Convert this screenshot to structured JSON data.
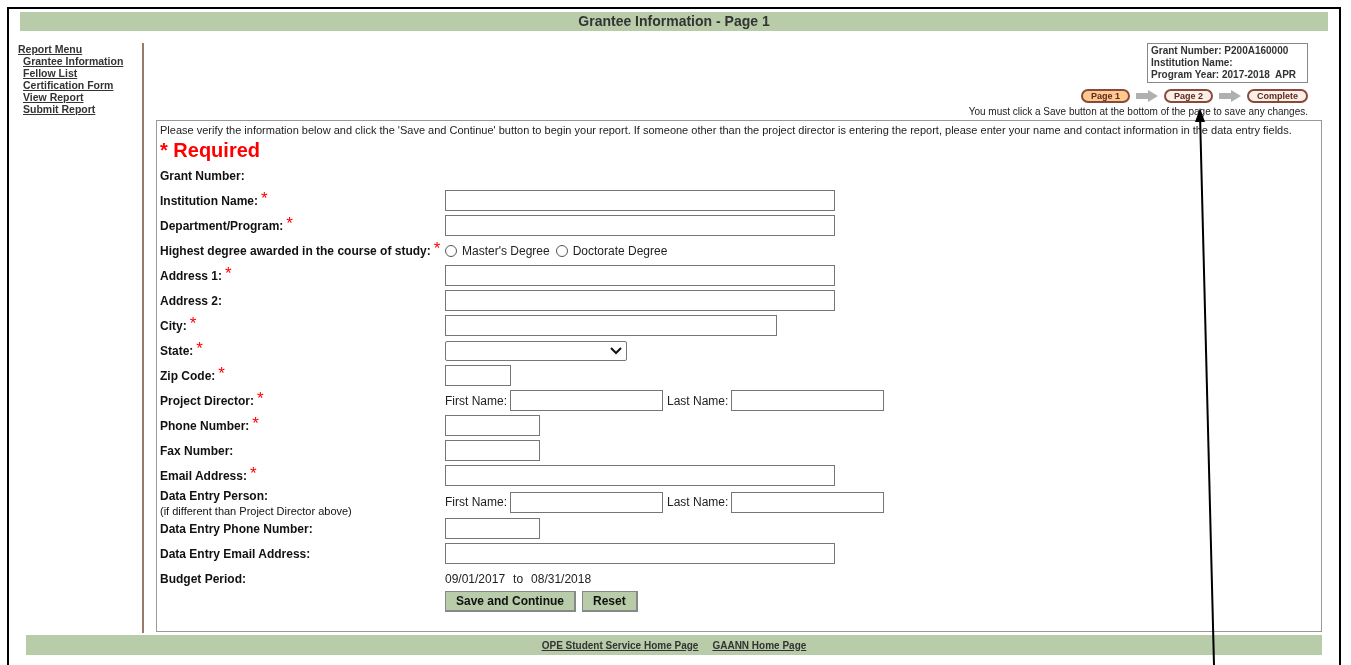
{
  "title": "Grantee Information - Page 1",
  "sidebar": {
    "heading": "Report Menu",
    "items": [
      {
        "label": "Grantee Information"
      },
      {
        "label": "Fellow List"
      },
      {
        "label": "Certification Form"
      },
      {
        "label": "View Report"
      },
      {
        "label": "Submit Report"
      }
    ]
  },
  "info_box": [
    "Grant Number: P200A160000",
    "Institution Name:",
    "Program Year: 2017-2018  APR"
  ],
  "steps": [
    {
      "label": "Page 1",
      "selected": true
    },
    {
      "label": "Page 2",
      "selected": false
    },
    {
      "label": "Complete",
      "selected": false
    }
  ],
  "save_notice": "You must click a Save button at the bottom of the page to save any changes.",
  "intro": "Please verify the information below and click the 'Save and Continue' button to begin your report. If someone other than the project director is entering the report, please enter your name and contact information in the data entry fields.",
  "required_legend": "* Required",
  "required_mark": "*",
  "rows": [
    {
      "kind": "none",
      "label": "Grant Number:",
      "required": false
    },
    {
      "kind": "long-input",
      "label": "Institution Name:",
      "required": true
    },
    {
      "kind": "long-input",
      "label": "Department/Program:",
      "required": true
    },
    {
      "kind": "radio",
      "label": "Highest degree awarded in the course of study:",
      "required": true,
      "options": [
        {
          "label": "Master's Degree",
          "selected": false
        },
        {
          "label": "Doctorate Degree",
          "selected": false
        }
      ]
    },
    {
      "kind": "long-input",
      "label": "Address 1:",
      "required": true
    },
    {
      "kind": "long-input",
      "label": "Address 2:",
      "required": false
    },
    {
      "kind": "medium-input",
      "label": "City:",
      "required": true
    },
    {
      "kind": "select",
      "label": "State:",
      "required": true
    },
    {
      "kind": "tiny-input",
      "label": "Zip Code:",
      "required": true
    },
    {
      "kind": "name",
      "label": "Project Director:",
      "required": true,
      "first": "First Name:",
      "last": "Last Name:"
    },
    {
      "kind": "short-input",
      "label": "Phone Number:",
      "required": true
    },
    {
      "kind": "short-input",
      "label": "Fax Number:",
      "required": false
    },
    {
      "kind": "long-input",
      "label": "Email Address:",
      "required": true
    },
    {
      "kind": "name",
      "label": "Data Entry Person:",
      "note": "(if different than Project Director above)",
      "required": false,
      "first": "First Name:",
      "last": "Last Name:"
    },
    {
      "kind": "short-input",
      "label": "Data Entry Phone Number:",
      "required": false
    },
    {
      "kind": "long-input",
      "label": "Data Entry Email Address:",
      "required": false
    },
    {
      "kind": "period",
      "label": "Budget Period:",
      "required": false,
      "from": "09/01/2017",
      "joiner": "to",
      "to": "08/31/2018"
    }
  ],
  "buttons": [
    {
      "label": "Save and Continue"
    },
    {
      "label": "Reset"
    }
  ],
  "footer_links": [
    {
      "label": "OPE Student Service Home Page"
    },
    {
      "label": "GAANN Home Page"
    }
  ]
}
